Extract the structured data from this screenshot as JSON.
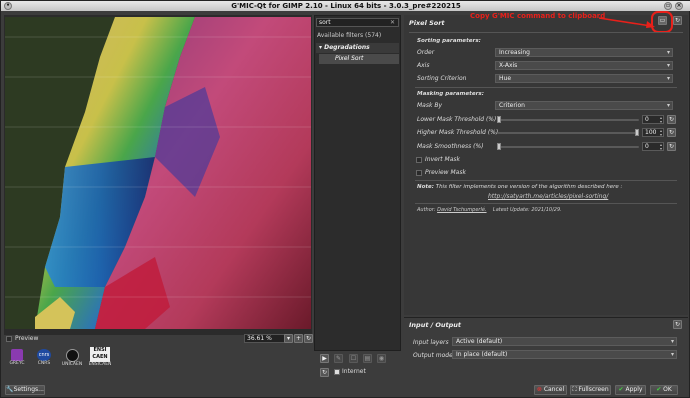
{
  "window": {
    "title": "G'MIC-Qt for GIMP 2.10 - Linux 64 bits - 3.0.3_pre#220215"
  },
  "annotation": {
    "text": "Copy G'MIC command to clipboard",
    "color": "#e8201a"
  },
  "preview": {
    "checkbox_label": "Preview",
    "zoom": "36.61 %"
  },
  "logos": [
    "GREYC",
    "CNRS",
    "UNICAEN",
    "ENSICAEN"
  ],
  "logo_marks": {
    "cnrs": "cnrs",
    "ensi_line1": "ENSI",
    "ensi_line2": "CAEN"
  },
  "settings_button": "Settings...",
  "filters": {
    "search_value": "sort",
    "available": "Available filters (574)",
    "category": "Degradations",
    "selected": "Pixel Sort",
    "internet_label": "Internet"
  },
  "filter": {
    "title": "Pixel Sort",
    "sorting_header": "Sorting parameters:",
    "order_label": "Order",
    "order_value": "Increasing",
    "axis_label": "Axis",
    "axis_value": "X-Axis",
    "criterion_label": "Sorting Criterion",
    "criterion_value": "Hue",
    "masking_header": "Masking parameters:",
    "mask_by_label": "Mask By",
    "mask_by_value": "Criterion",
    "lower_label": "Lower Mask Threshold (%)",
    "lower_value": "0",
    "lower_level": 0,
    "higher_label": "Higher Mask Threshold (%)",
    "higher_value": "100",
    "higher_level": 1,
    "smooth_label": "Mask Smoothness (%)",
    "smooth_value": "0",
    "smooth_level": 0,
    "invert_label": "Invert Mask",
    "preview_mask_label": "Preview Mask",
    "note_bold": "Note:",
    "note_text": "This filter implements one version of the algorithm described here :",
    "note_link": "http://satyarth.me/articles/pixel-sorting/",
    "author_prefix": "Author:",
    "author_name": "David Tschumperlé.",
    "update": "Latest Update: 2021/10/29."
  },
  "io": {
    "title": "Input / Output",
    "layers_label": "Input layers",
    "layers_value": "Active (default)",
    "mode_label": "Output mode",
    "mode_value": "In place (default)"
  },
  "buttons": {
    "cancel": "Cancel",
    "fullscreen": "Fullscreen",
    "apply": "Apply",
    "ok": "OK"
  }
}
